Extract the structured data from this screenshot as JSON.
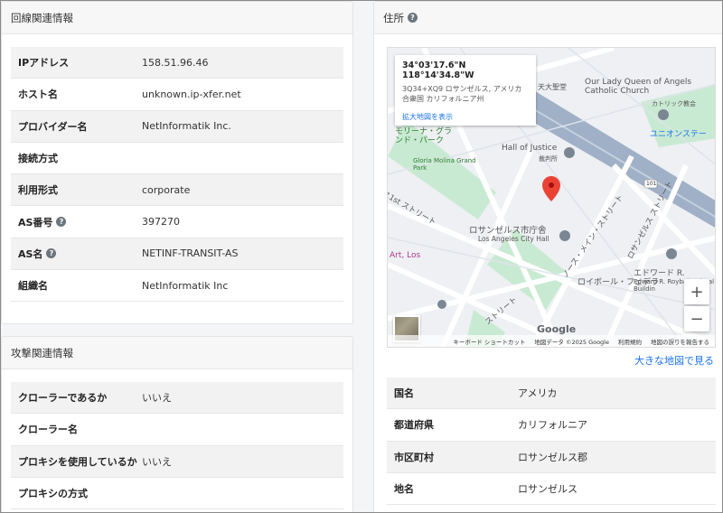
{
  "line_card": {
    "title": "回線関連情報",
    "rows": [
      {
        "label": "IPアドレス",
        "value": "158.51.96.46",
        "help": false
      },
      {
        "label": "ホスト名",
        "value": "unknown.ip-xfer.net",
        "help": false
      },
      {
        "label": "プロバイダー名",
        "value": "NetInformatik Inc.",
        "help": false
      },
      {
        "label": "接続方式",
        "value": "",
        "help": false
      },
      {
        "label": "利用形式",
        "value": "corporate",
        "help": false
      },
      {
        "label": "AS番号",
        "value": "397270",
        "help": true
      },
      {
        "label": "AS名",
        "value": "NETINF-TRANSIT-AS",
        "help": true
      },
      {
        "label": "組織名",
        "value": "NetInformatik Inc",
        "help": false
      }
    ]
  },
  "attack_card": {
    "title": "攻撃関連情報",
    "rows": [
      {
        "label": "クローラーであるか",
        "value": "いいえ"
      },
      {
        "label": "クローラー名",
        "value": ""
      },
      {
        "label": "プロキシを使用しているか",
        "value": "いいえ"
      },
      {
        "label": "プロキシの方式",
        "value": ""
      }
    ]
  },
  "address_card": {
    "title": "住所",
    "help_icon": "question-circle-icon",
    "map": {
      "coords": "34°03'17.6\"N 118°14'34.8\"W",
      "address": "3Q34+XQ9 ロサンゼルス, アメリカ合衆国 カリフォルニア州",
      "enlarge_link": "拡大地図を表示",
      "footer_items": [
        "キーボード ショートカット",
        "地図データ ©2025 Google",
        "利用規約",
        "地図の誤りを報告する"
      ],
      "zoom_in": "+",
      "zoom_out": "−",
      "google": "Google",
      "labels": {
        "cathedral": "Our Lady Queen of Angels Catholic Church",
        "cathedral_ja": "カトリック教会",
        "cathedral_top": "天大聖堂",
        "hall_of_justice": "Hall of Justice",
        "hall_ja": "裁判所",
        "city_hall_ja": "ロサンゼルス市庁舎",
        "city_hall": "Los Angeles City Hall",
        "park_ja": "モリーナ・グランド・パーク",
        "park": "Gloria Molina Grand Park",
        "union": "ユニオンステー",
        "street_1st": "ス1st ストリート",
        "edward_ja": "エドワード R.",
        "edward": "Edward R. Roybal Federal Buildin",
        "roybal_ja": "ロイボール・フェデラ",
        "main_st": "ノース・メイン・ストリート",
        "la_st": "ロサンゼルス ストリート",
        "art": "Art, Los",
        "strt": "ストリート",
        "num101": "101"
      }
    },
    "big_map_link": "大きな地図で見る",
    "rows": [
      {
        "label": "国名",
        "value": "アメリカ"
      },
      {
        "label": "都道府県",
        "value": "カリフォルニア"
      },
      {
        "label": "市区町村",
        "value": "ロサンゼルス郡"
      },
      {
        "label": "地名",
        "value": "ロサンゼルス"
      }
    ]
  }
}
